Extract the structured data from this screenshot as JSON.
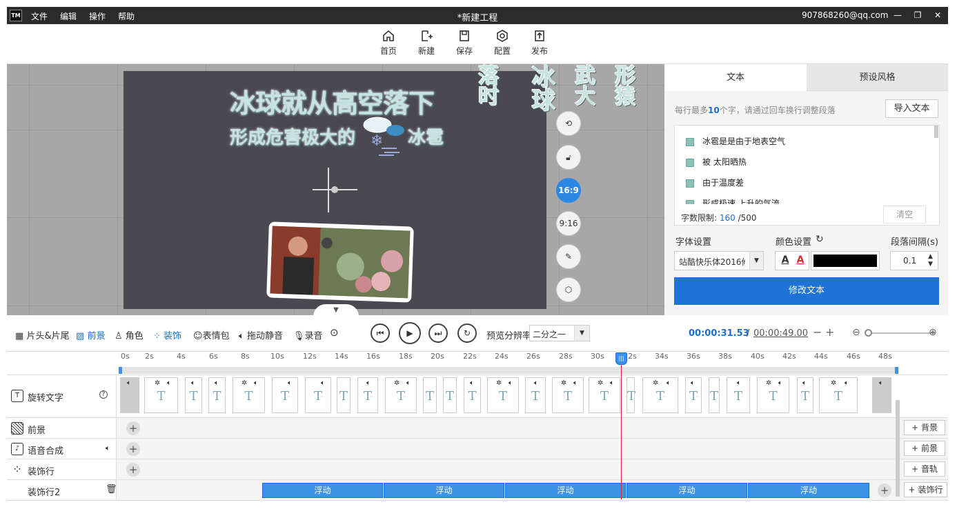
{
  "titlebar": {
    "logo": "TM",
    "menu": [
      "文件",
      "编辑",
      "操作",
      "帮助"
    ],
    "title": "*新建工程",
    "email": "907868260@qq.com"
  },
  "toolbar": [
    {
      "label": "首页",
      "icon": "home-icon"
    },
    {
      "label": "新建",
      "icon": "new-file-icon"
    },
    {
      "label": "保存",
      "icon": "save-icon"
    },
    {
      "label": "配置",
      "icon": "gear-icon"
    },
    {
      "label": "发布",
      "icon": "publish-icon"
    }
  ],
  "canvas": {
    "headline": "冰球就从高空落下",
    "subline_a": "形成危害极大的",
    "subline_b": "冰雹",
    "vertical_texts": [
      "冰球",
      "落时",
      "武大",
      "形猿"
    ],
    "side_buttons": [
      "rotate-icon",
      "unlock-icon",
      "16:9",
      "9:16",
      "edit-icon",
      "gear-icon"
    ],
    "active_ratio": "16:9"
  },
  "right_panel": {
    "tabs": [
      "文本",
      "预设风格"
    ],
    "hint_prefix": "每行最多",
    "hint_num": "10",
    "hint_suffix": "个字，请通过回车换行调整段落",
    "import_btn": "导入文本",
    "lines": [
      "冰雹是是由于地表空气",
      "被 太阳晒热",
      "由于温度差",
      "形成极速 上升的气流"
    ],
    "char_limit_label": "字数限制:",
    "char_count": "160",
    "char_max": "/500",
    "clear_btn": "清空",
    "font_label": "字体设置",
    "font_value": "站酷快乐体2016修",
    "color_label": "颜色设置",
    "spacing_label": "段落间隔(s)",
    "spacing_value": "0.1",
    "color_value": "#000000",
    "modify_btn": "修改文本"
  },
  "timeline_bar": {
    "items": [
      "片头&片尾",
      "前景",
      "角色",
      "装饰",
      "表情包",
      "拖动静音",
      "录音"
    ],
    "preview_label": "预览分辨率",
    "preview_value": "二分之一",
    "time_current": "00:00:31.53",
    "time_sep": "/",
    "time_total": "00:00:49.00"
  },
  "ruler": {
    "ticks": [
      "0s",
      "2s",
      "4s",
      "6s",
      "8s",
      "10s",
      "12s",
      "14s",
      "16s",
      "18s",
      "20s",
      "22s",
      "24s",
      "26s",
      "28s",
      "30s",
      "32s",
      "34s",
      "36s",
      "38s",
      "40s",
      "42s",
      "44s",
      "46s",
      "48s"
    ]
  },
  "tracks": [
    {
      "name": "旋转文字",
      "icon": "text-icon"
    },
    {
      "name": "前景",
      "icon": "foreground-icon",
      "add": "背景"
    },
    {
      "name": "语音合成",
      "icon": "music-icon",
      "add": "前景"
    },
    {
      "name": "装饰行",
      "icon": "decoration-icon",
      "add": "音轨"
    },
    {
      "name": "装饰行2",
      "icon": "trash-icon",
      "add": "装饰行"
    }
  ],
  "float_clips": [
    "浮动",
    "浮动",
    "浮动",
    "浮动",
    "浮动"
  ],
  "colors": {
    "accent": "#1a6fd1",
    "button": "#1f72d6",
    "titlebar": "#2b2b2b",
    "canvas": "#4a4950",
    "playhead": "#d9262c"
  }
}
